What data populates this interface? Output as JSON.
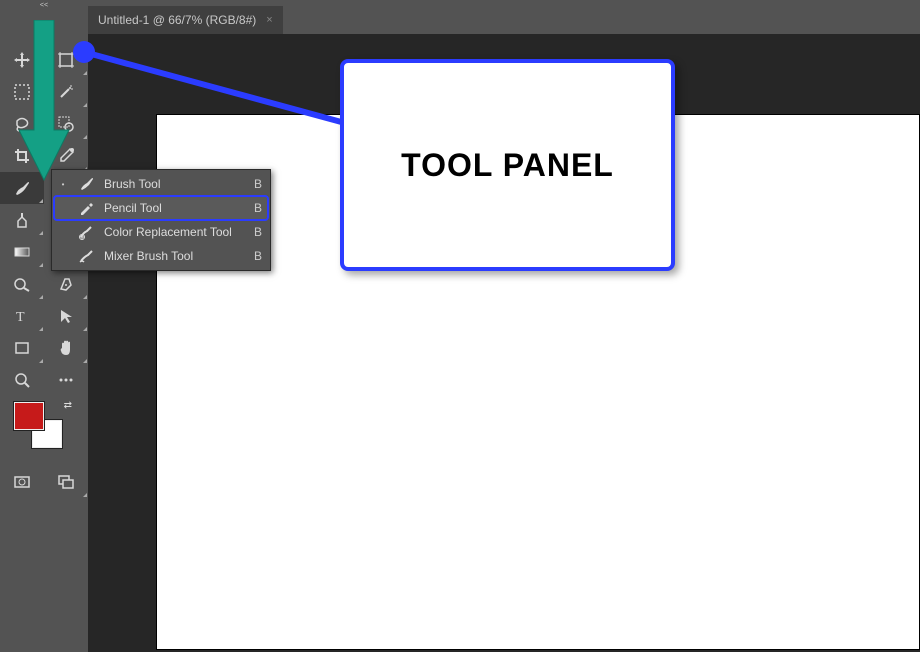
{
  "collapse_label": "<<",
  "tab": {
    "title": "Untitled-1 @ 66/7% (RGB/8#)",
    "close": "×"
  },
  "tools_left": [
    "move",
    "marquee",
    "lasso",
    "crop",
    "eyedropper",
    "brush",
    "clone",
    "eraser",
    "gradient",
    "dodge",
    "pen",
    "text",
    "rectangle",
    "hand",
    "zoom"
  ],
  "tools_right": [
    "artboard",
    "magic-wand",
    "slice",
    "frame",
    "ruler",
    "spot-heal",
    "history-brush",
    "blur",
    "paint-bucket",
    "sponge",
    "path-select",
    "direct-select",
    "shape",
    "rotate",
    "more"
  ],
  "flyout": {
    "items": [
      {
        "marker": "•",
        "label": "Brush Tool",
        "shortcut": "B",
        "icon": "brush-icon",
        "highlight": false
      },
      {
        "marker": "",
        "label": "Pencil Tool",
        "shortcut": "B",
        "icon": "pencil-icon",
        "highlight": true
      },
      {
        "marker": "",
        "label": "Color Replacement Tool",
        "shortcut": "B",
        "icon": "color-replace-icon",
        "highlight": false
      },
      {
        "marker": "",
        "label": "Mixer Brush Tool",
        "shortcut": "B",
        "icon": "mixer-brush-icon",
        "highlight": false
      }
    ]
  },
  "callout": {
    "text": "TOOL PANEL"
  },
  "colors": {
    "foreground": "#c61a1a",
    "background": "#ffffff"
  },
  "annotation_arrow_color": "#14a085"
}
